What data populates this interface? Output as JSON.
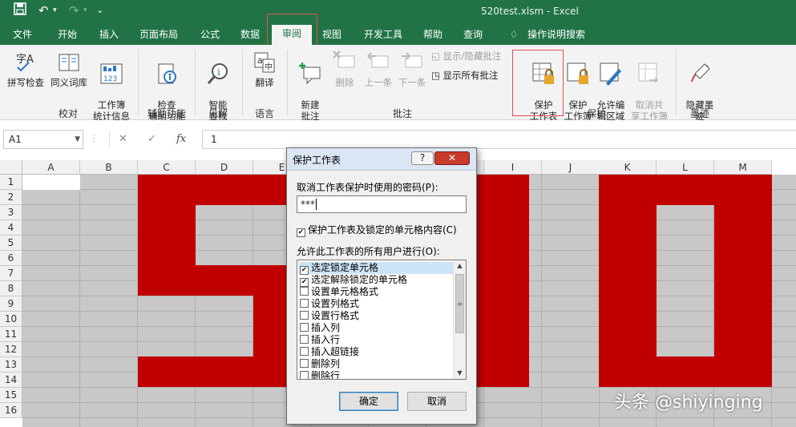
{
  "title_bar": {
    "doc_title": "520test.xlsm  -  Excel"
  },
  "tabs": [
    "文件",
    "开始",
    "插入",
    "页面布局",
    "公式",
    "数据",
    "审阅",
    "视图",
    "开发工具",
    "帮助",
    "查询",
    "操作说明搜索"
  ],
  "active_tab": "审阅",
  "ribbon": {
    "groups": {
      "proofing": {
        "label": "校对",
        "buttons": [
          "拼写检查",
          "同义词库",
          "工作簿\n统计信息"
        ]
      },
      "accessibility": {
        "label": "辅助功能",
        "button": "检查\n辅助功能"
      },
      "insights": {
        "label": "见解",
        "button": "智能\n查找"
      },
      "language": {
        "label": "语言",
        "button": "翻译"
      },
      "comments": {
        "label": "批注",
        "new": "新建\n批注",
        "delete": "删除",
        "prev": "上一条",
        "next": "下一条",
        "show_hide": "显示/隐藏批注",
        "show_all": "显示所有批注"
      },
      "protect": {
        "label": "保护",
        "protect_sheet": "保护\n工作表",
        "protect_workbook": "保护\n工作簿",
        "allow_edit": "允许编\n辑区域",
        "unshare": "取消共\n享工作簿"
      },
      "ink": {
        "label": "墨迹",
        "hide_ink": "隐藏墨\n迹"
      }
    }
  },
  "formula_bar": {
    "name_box": "A1",
    "cancel": "✕",
    "enter": "✓",
    "fx": "fx",
    "content": "1"
  },
  "columns": [
    "A",
    "B",
    "C",
    "D",
    "E",
    "F",
    "G",
    "H",
    "I",
    "J",
    "K",
    "L",
    "M"
  ],
  "rows": [
    "1",
    "2",
    "3",
    "4",
    "5",
    "6",
    "7",
    "8",
    "9",
    "10",
    "11",
    "12",
    "13",
    "14",
    "15",
    "16"
  ],
  "dialog": {
    "title": "保护工作表",
    "help": "?",
    "close": "✕",
    "password_label": "取消工作表保护时使用的密码(P):",
    "password_value": "***",
    "protect_check_label": "保护工作表及锁定的单元格内容(C)",
    "protect_checked": true,
    "allow_label": "允许此工作表的所有用户进行(O):",
    "permissions": [
      {
        "label": "选定锁定单元格",
        "checked": true
      },
      {
        "label": "选定解除锁定的单元格",
        "checked": true
      },
      {
        "label": "设置单元格格式",
        "checked": false
      },
      {
        "label": "设置列格式",
        "checked": false
      },
      {
        "label": "设置行格式",
        "checked": false
      },
      {
        "label": "插入列",
        "checked": false
      },
      {
        "label": "插入行",
        "checked": false
      },
      {
        "label": "插入超链接",
        "checked": false
      },
      {
        "label": "删除列",
        "checked": false
      },
      {
        "label": "删除行",
        "checked": false
      }
    ],
    "ok": "确定",
    "cancel": "取消"
  },
  "watermark": "头条 @shiyinging",
  "colors": {
    "excel_green": "#217346",
    "sheet_red": "#c00000",
    "sheet_gray": "#c8c8c8"
  }
}
